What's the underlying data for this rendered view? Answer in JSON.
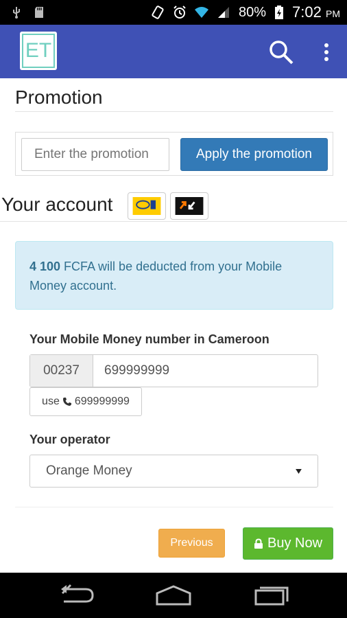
{
  "status_bar": {
    "battery_percent": "80%",
    "time": "7:02",
    "ampm": "PM"
  },
  "app_bar": {
    "logo_text": "ET"
  },
  "promotion": {
    "title": "Promotion",
    "input_placeholder": "Enter the promotion",
    "apply_label": "Apply the promotion"
  },
  "account": {
    "title": "Your account",
    "operators": [
      "mtn-mobile-money",
      "orange-money"
    ]
  },
  "alert": {
    "amount": "4 100",
    "message": " FCFA will be deducted from your Mobile Money account."
  },
  "form": {
    "number_label": "Your Mobile Money number in Cameroon",
    "country_code": "00237",
    "number_value": "699999999",
    "use_prefix": "use",
    "use_number": "699999999",
    "operator_label": "Your operator",
    "operator_selected": "Orange Money"
  },
  "actions": {
    "previous_label": "Previous",
    "buy_label": "Buy Now"
  },
  "colors": {
    "appbar": "#3f51b5",
    "primary": "#337ab7",
    "warning": "#f0ad4e",
    "success": "#5cb82e",
    "info_bg": "#d9edf7"
  }
}
